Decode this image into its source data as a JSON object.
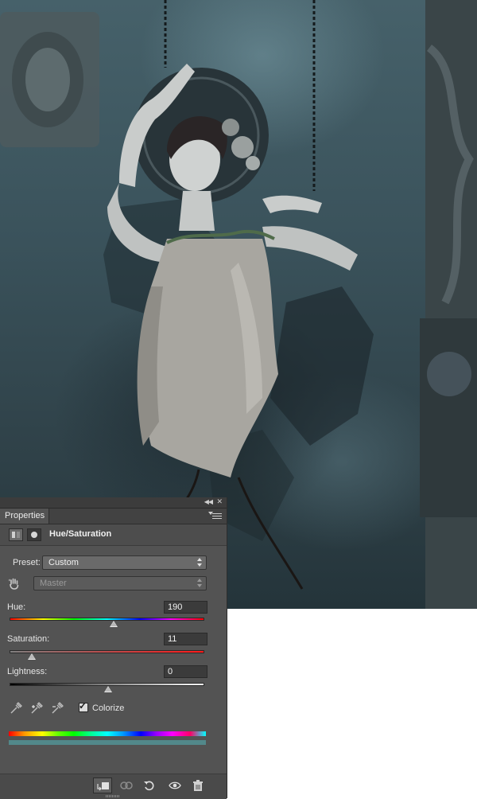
{
  "panel": {
    "tab_label": "Properties",
    "adjustment_title": "Hue/Saturation",
    "preset": {
      "label": "Preset:",
      "value": "Custom"
    },
    "channel": {
      "value": "Master"
    },
    "hue": {
      "label": "Hue:",
      "value": "190",
      "slider_fraction": 0.53
    },
    "saturation": {
      "label": "Saturation:",
      "value": "11",
      "slider_fraction": 0.11
    },
    "lightness": {
      "label": "Lightness:",
      "value": "0",
      "slider_fraction": 0.5
    },
    "colorize": {
      "label": "Colorize",
      "checked": true
    },
    "result_color": "#52888a"
  },
  "icons": {
    "header": [
      "adjustment-layer-icon",
      "mask-icon"
    ],
    "eyedroppers": [
      "eyedropper-icon",
      "eyedropper-plus-icon",
      "eyedropper-minus-icon"
    ],
    "bottom": [
      "clip-to-layer-icon",
      "view-previous-icon",
      "reset-icon",
      "visibility-eye-icon",
      "delete-trash-icon"
    ]
  }
}
